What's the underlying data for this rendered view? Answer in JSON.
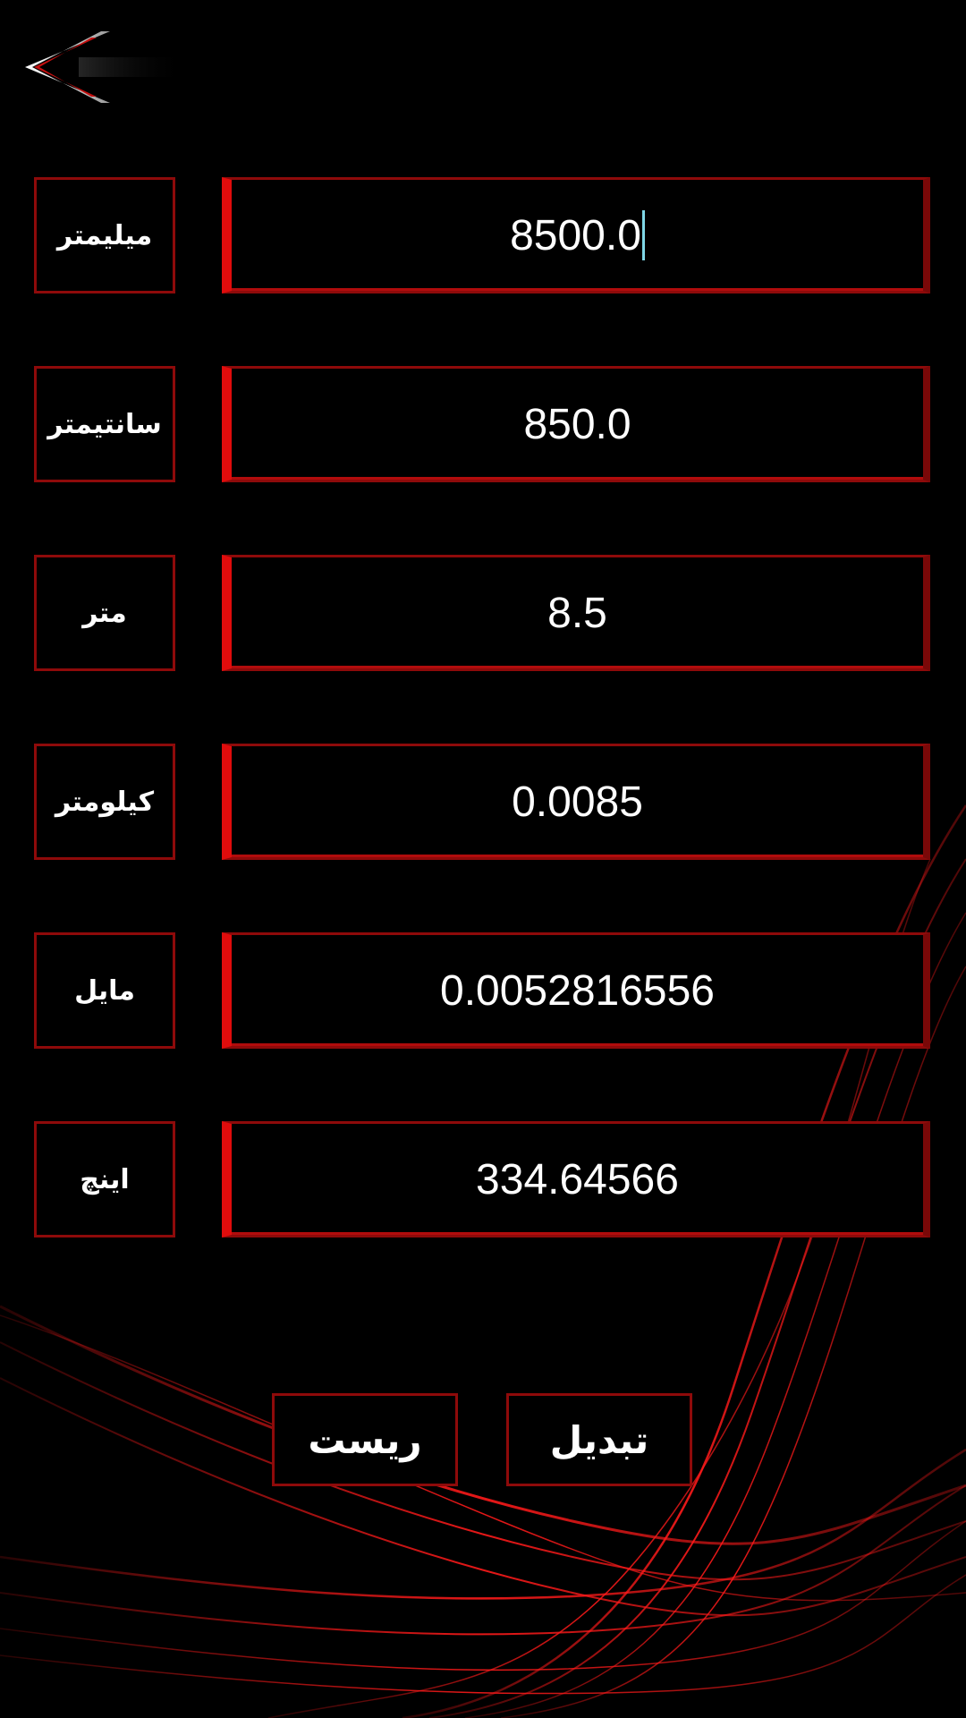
{
  "theme": {
    "background": "#000000",
    "accent": "#e00c0c",
    "border": "#8e0a0a",
    "text": "#ffffff",
    "caret": "#7fd6e6"
  },
  "toolbar": {
    "back_icon": "chevron-left-icon"
  },
  "rows": [
    {
      "unit": "میلیمتر",
      "value": "8500.0"
    },
    {
      "unit": "سانتیمتر",
      "value": "850.0"
    },
    {
      "unit": "متر",
      "value": "8.5"
    },
    {
      "unit": "کیلومتر",
      "value": "0.0085"
    },
    {
      "unit": "مایل",
      "value": "0.0052816556"
    },
    {
      "unit": "اینچ",
      "value": "334.64566"
    }
  ],
  "actions": {
    "reset_label": "ریست",
    "convert_label": "تبدیل"
  }
}
